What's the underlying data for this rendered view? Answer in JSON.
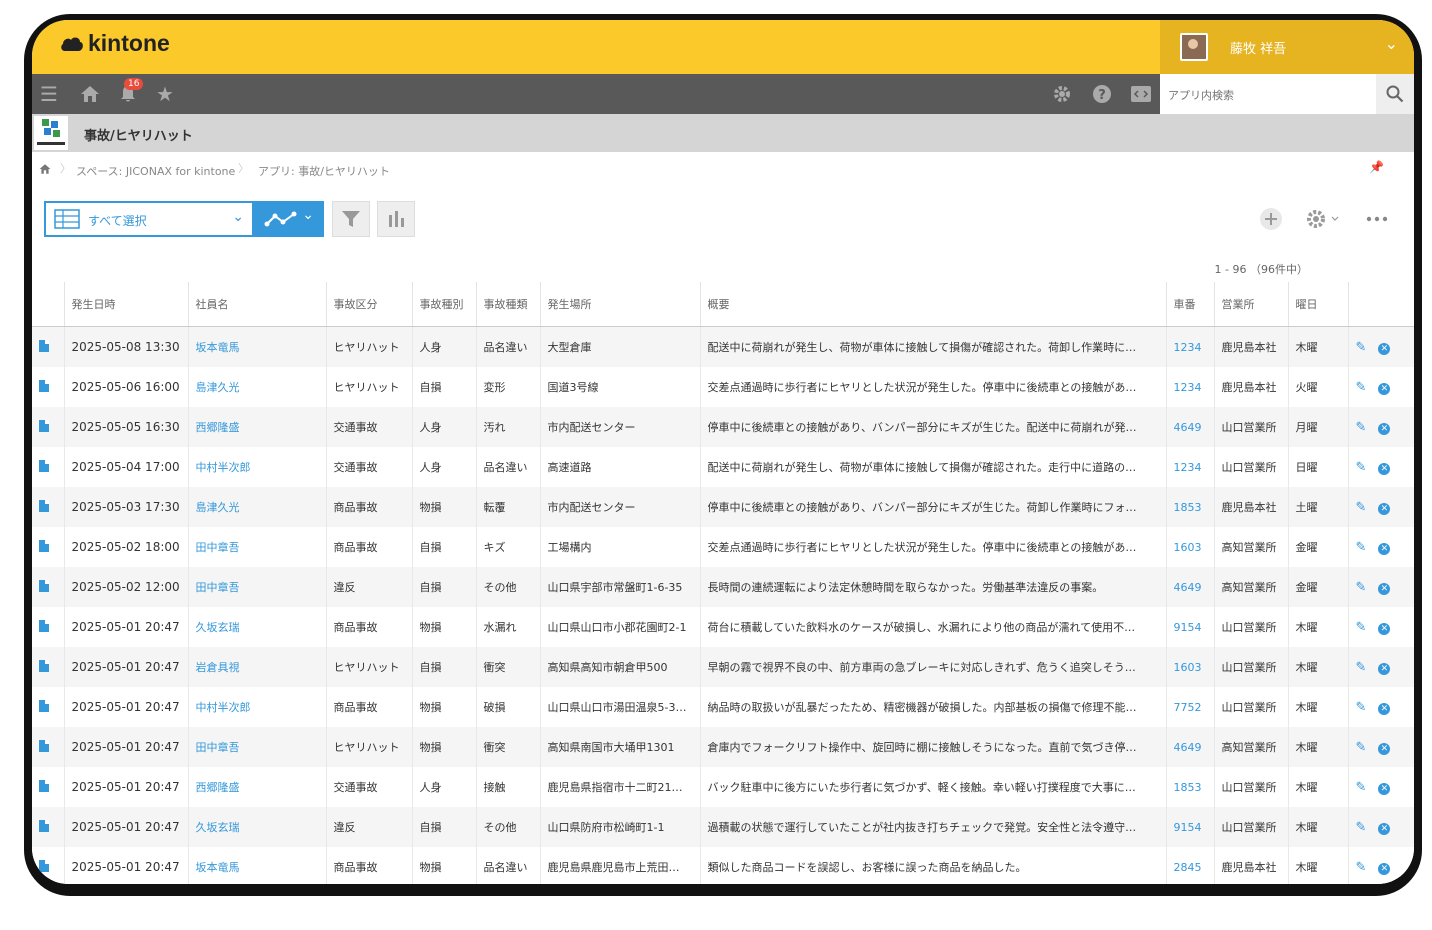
{
  "header": {
    "logo_text": "kintone",
    "user_name": "藤牧 祥吾",
    "notification_count": "16",
    "search_placeholder": "アプリ内検索"
  },
  "app": {
    "title": "事故/ヒヤリハット",
    "breadcrumb": [
      "スペース: JICONAX for kintone",
      "アプリ: 事故/ヒヤリハット"
    ]
  },
  "toolbar": {
    "view_label": "すべて選択",
    "record_count": "1 - 96 （96件中）"
  },
  "table": {
    "columns": [
      "発生日時",
      "社員名",
      "事故区分",
      "事故種別",
      "事故種類",
      "発生場所",
      "概要",
      "車番",
      "営業所",
      "曜日"
    ],
    "rows": [
      [
        "2025-05-08 13:30",
        "坂本竜馬",
        "ヒヤリハット",
        "人身",
        "品名違い",
        "大型倉庫",
        "配送中に荷崩れが発生し、荷物が車体に接触して損傷が確認された。荷卸し作業時に…",
        "1234",
        "鹿児島本社",
        "木曜"
      ],
      [
        "2025-05-06 16:00",
        "島津久光",
        "ヒヤリハット",
        "自損",
        "変形",
        "国道3号線",
        "交差点通過時に歩行者にヒヤリとした状況が発生した。停車中に後続車との接触があ…",
        "1234",
        "鹿児島本社",
        "火曜"
      ],
      [
        "2025-05-05 16:30",
        "西郷隆盛",
        "交通事故",
        "人身",
        "汚れ",
        "市内配送センター",
        "停車中に後続車との接触があり、バンパー部分にキズが生じた。配送中に荷崩れが発…",
        "4649",
        "山口営業所",
        "月曜"
      ],
      [
        "2025-05-04 17:00",
        "中村半次郎",
        "交通事故",
        "人身",
        "品名違い",
        "高速道路",
        "配送中に荷崩れが発生し、荷物が車体に接触して損傷が確認された。走行中に道路の…",
        "1234",
        "山口営業所",
        "日曜"
      ],
      [
        "2025-05-03 17:30",
        "島津久光",
        "商品事故",
        "物損",
        "転覆",
        "市内配送センター",
        "停車中に後続車との接触があり、バンパー部分にキズが生じた。荷卸し作業時にフォ…",
        "1853",
        "鹿児島本社",
        "土曜"
      ],
      [
        "2025-05-02 18:00",
        "田中章吾",
        "商品事故",
        "自損",
        "キズ",
        "工場構内",
        "交差点通過時に歩行者にヒヤリとした状況が発生した。停車中に後続車との接触があ…",
        "1603",
        "高知営業所",
        "金曜"
      ],
      [
        "2025-05-02 12:00",
        "田中章吾",
        "違反",
        "自損",
        "その他",
        "山口県宇部市常盤町1-6-35",
        "長時間の連続運転により法定休憩時間を取らなかった。労働基準法違反の事案。",
        "4649",
        "高知営業所",
        "金曜"
      ],
      [
        "2025-05-01 20:47",
        "久坂玄瑞",
        "商品事故",
        "物損",
        "水漏れ",
        "山口県山口市小郡花園町2-1",
        "荷台に積載していた飲料水のケースが破損し、水漏れにより他の商品が濡れて使用不…",
        "9154",
        "山口営業所",
        "木曜"
      ],
      [
        "2025-05-01 20:47",
        "岩倉具視",
        "ヒヤリハット",
        "自損",
        "衝突",
        "高知県高知市朝倉甲500",
        "早朝の霧で視界不良の中、前方車両の急ブレーキに対応しきれず、危うく追突しそう…",
        "1603",
        "山口営業所",
        "木曜"
      ],
      [
        "2025-05-01 20:47",
        "中村半次郎",
        "商品事故",
        "物損",
        "破損",
        "山口県山口市湯田温泉5-3…",
        "納品時の取扱いが乱暴だったため、精密機器が破損した。内部基板の損傷で修理不能…",
        "7752",
        "山口営業所",
        "木曜"
      ],
      [
        "2025-05-01 20:47",
        "田中章吾",
        "ヒヤリハット",
        "物損",
        "衝突",
        "高知県南国市大埇甲1301",
        "倉庫内でフォークリフト操作中、旋回時に棚に接触しそうになった。直前で気づき停…",
        "4649",
        "高知営業所",
        "木曜"
      ],
      [
        "2025-05-01 20:47",
        "西郷隆盛",
        "交通事故",
        "人身",
        "接触",
        "鹿児島県指宿市十二町21…",
        "バック駐車中に後方にいた歩行者に気づかず、軽く接触。幸い軽い打撲程度で大事に…",
        "1853",
        "山口営業所",
        "木曜"
      ],
      [
        "2025-05-01 20:47",
        "久坂玄瑞",
        "違反",
        "自損",
        "その他",
        "山口県防府市松崎町1-1",
        "過積載の状態で運行していたことが社内抜き打ちチェックで発覚。安全性と法令遵守…",
        "9154",
        "山口営業所",
        "木曜"
      ],
      [
        "2025-05-01 20:47",
        "坂本竜馬",
        "商品事故",
        "物損",
        "品名違い",
        "鹿児島県鹿児島市上荒田…",
        "類似した商品コードを誤認し、お客様に誤った商品を納品した。",
        "2845",
        "鹿児島本社",
        "木曜"
      ]
    ]
  }
}
